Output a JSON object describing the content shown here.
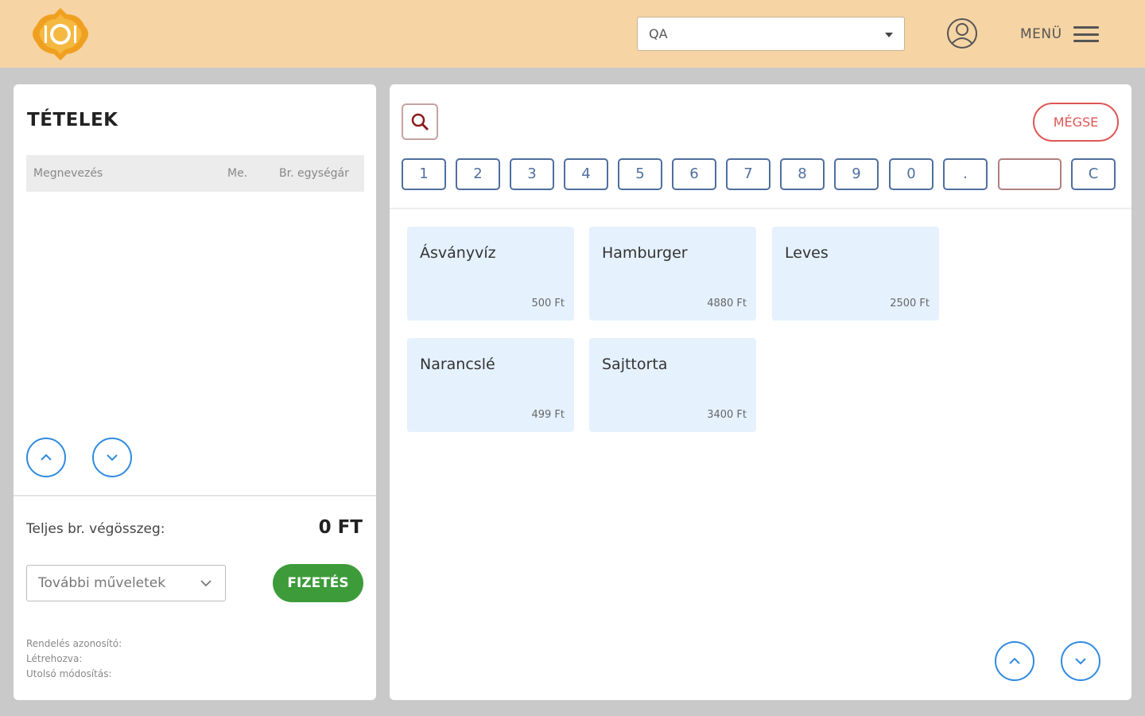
{
  "header": {
    "logo_icon": "restaurant-plate-icon",
    "select_value": "QA",
    "user_icon": "user-icon",
    "menu_label": "MENÜ",
    "menu_icon": "hamburger-menu-icon"
  },
  "left": {
    "title": "TÉTELEK",
    "columns": [
      "Megnevezés",
      "Me.",
      "Br. egységár"
    ],
    "total_label": "Teljes br. végösszeg:",
    "total_value": "0 FT",
    "ops_label": "További műveletek",
    "pay_label": "FIZETÉS",
    "meta": [
      "Rendelés azonosító:",
      "Létrehozva:",
      "Utolsó módosítás:"
    ]
  },
  "right": {
    "cancel_label": "MÉGSE",
    "keys": [
      "1",
      "2",
      "3",
      "4",
      "5",
      "6",
      "7",
      "8",
      "9",
      "0",
      ".",
      "",
      "C"
    ],
    "products": [
      {
        "name": "Ásványvíz",
        "price": "500 Ft"
      },
      {
        "name": "Hamburger",
        "price": "4880 Ft"
      },
      {
        "name": "Leves",
        "price": "2500 Ft"
      },
      {
        "name": "Narancslé",
        "price": "499 Ft"
      },
      {
        "name": "Sajttorta",
        "price": "3400 Ft"
      }
    ]
  },
  "colors": {
    "header_bg": "#f6d4a4",
    "accent_blue": "#2f8ae0",
    "pay_green": "#3d9b3a",
    "cancel_red": "#e05555",
    "product_bg": "#e5f1fd"
  }
}
